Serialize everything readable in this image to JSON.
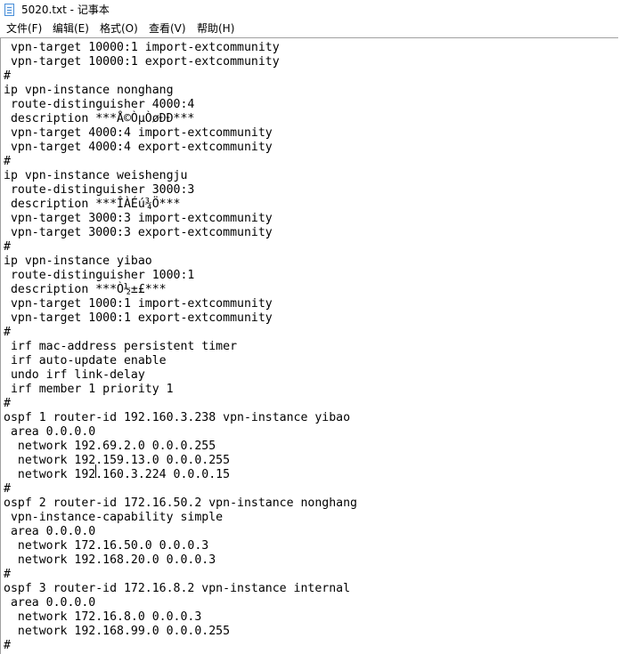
{
  "window": {
    "title": "5020.txt - 记事本"
  },
  "menu": {
    "file": "文件(F)",
    "edit": "编辑(E)",
    "format": "格式(O)",
    "view": "查看(V)",
    "help": "帮助(H)"
  },
  "editor": {
    "lines": [
      " vpn-target 10000:1 import-extcommunity",
      " vpn-target 10000:1 export-extcommunity",
      "#",
      "ip vpn-instance nonghang",
      " route-distinguisher 4000:4",
      " description ***Å©ÒµÒøÐÐ***",
      " vpn-target 4000:4 import-extcommunity",
      " vpn-target 4000:4 export-extcommunity",
      "#",
      "ip vpn-instance weishengju",
      " route-distinguisher 3000:3",
      " description ***ÎÀÉú¾Ö***",
      " vpn-target 3000:3 import-extcommunity",
      " vpn-target 3000:3 export-extcommunity",
      "#",
      "ip vpn-instance yibao",
      " route-distinguisher 1000:1",
      " description ***Ò½±£***",
      " vpn-target 1000:1 import-extcommunity",
      " vpn-target 1000:1 export-extcommunity",
      "#",
      " irf mac-address persistent timer",
      " irf auto-update enable",
      " undo irf link-delay",
      " irf member 1 priority 1",
      "#",
      "ospf 1 router-id 192.160.3.238 vpn-instance yibao",
      " area 0.0.0.0",
      "  network 192.69.2.0 0.0.0.255",
      "  network 192.159.13.0 0.0.0.255",
      "  network 192.160.3.224 0.0.0.15",
      "#",
      "ospf 2 router-id 172.16.50.2 vpn-instance nonghang",
      " vpn-instance-capability simple",
      " area 0.0.0.0",
      "  network 172.16.50.0 0.0.0.3",
      "  network 192.168.20.0 0.0.0.3",
      "#",
      "ospf 3 router-id 172.16.8.2 vpn-instance internal",
      " area 0.0.0.0",
      "  network 172.16.8.0 0.0.0.3",
      "  network 192.168.99.0 0.0.0.255",
      "#"
    ]
  }
}
